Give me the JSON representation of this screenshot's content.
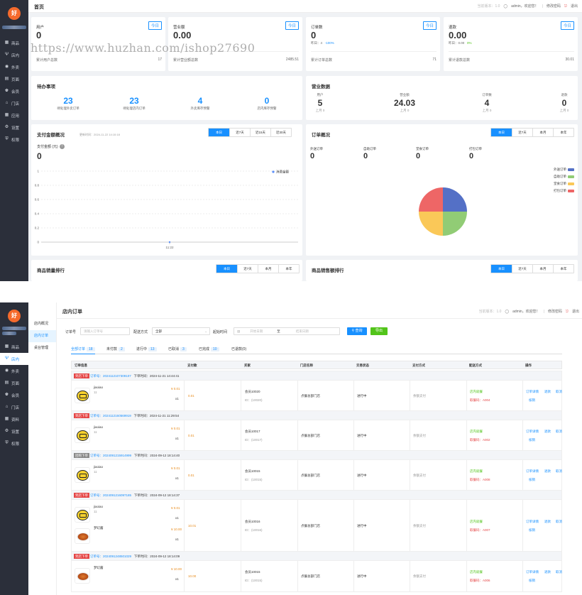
{
  "colors": {
    "sidebar": "#2b2f3a",
    "primary": "#1890ff",
    "logo": "#f56a2c",
    "pie": [
      "#5470c6",
      "#91cc75",
      "#fac858",
      "#ee6666"
    ]
  },
  "sidebar": {
    "logo": "好",
    "items1": [
      {
        "label": "商品",
        "icon": "grid-icon"
      },
      {
        "label": "店内",
        "icon": "fork-icon"
      },
      {
        "label": "外卖",
        "icon": "bag-icon"
      },
      {
        "label": "页面",
        "icon": "page-icon"
      },
      {
        "label": "会员",
        "icon": "crown-icon"
      },
      {
        "label": "门店",
        "icon": "store-icon"
      },
      {
        "label": "应用",
        "icon": "apps-icon"
      },
      {
        "label": "设置",
        "icon": "gear-icon"
      },
      {
        "label": "权限",
        "icon": "shield-icon"
      }
    ],
    "items2": [
      {
        "label": "商品",
        "icon": "grid-icon"
      },
      {
        "label": "店内",
        "icon": "fork-icon"
      },
      {
        "label": "外卖",
        "icon": "bag-icon"
      },
      {
        "label": "页面",
        "icon": "page-icon"
      },
      {
        "label": "会员",
        "icon": "crown-icon"
      },
      {
        "label": "门店",
        "icon": "store-icon"
      },
      {
        "label": "资料",
        "icon": "apps-icon"
      },
      {
        "label": "设置",
        "icon": "gear-icon"
      },
      {
        "label": "权限",
        "icon": "shield-icon"
      }
    ]
  },
  "header": {
    "title1": "首页",
    "title2": "店内订单",
    "version": "当前版本：1.0",
    "user": "admin，欢迎您！",
    "change_pwd": "修改密码",
    "logout": "退出"
  },
  "watermark": "https://www.huzhan.com/ishop27690",
  "stats": [
    {
      "title": "用户",
      "badge": "今日",
      "value": "0",
      "sub_label": "",
      "sub_a": "",
      "sub_b": "",
      "foot_label": "累计用户总数",
      "foot_value": "17"
    },
    {
      "title": "营业额",
      "badge": "今日",
      "value": "0.00",
      "sub_label": "",
      "sub_a": "",
      "sub_b": "",
      "foot_label": "累计营业额总数",
      "foot_value": "2485.51"
    },
    {
      "title": "订单数",
      "badge": "今日",
      "value": "0",
      "sub_label": "昨日：4",
      "sub_a": "-100%",
      "sub_b": "",
      "foot_label": "累计订单总数",
      "foot_value": "71"
    },
    {
      "title": "退款",
      "badge": "今日",
      "value": "0.00",
      "sub_label": "昨日：0.00",
      "sub_a": "0%",
      "sub_b": "",
      "foot_label": "累计退款总数",
      "foot_value": "30.01"
    }
  ],
  "todo": {
    "title": "待办事项",
    "items": [
      {
        "value": "23",
        "label": "待处理外卖订单"
      },
      {
        "value": "23",
        "label": "待处理店内订单"
      },
      {
        "value": "4",
        "label": "外卖库存预警"
      },
      {
        "value": "0",
        "label": "店内库存预警"
      }
    ]
  },
  "business": {
    "title": "营业数据",
    "items": [
      {
        "label": "用户",
        "value": "5",
        "sub": "上月 0"
      },
      {
        "label": "营业额",
        "value": "24.03",
        "sub": "上月 0"
      },
      {
        "label": "订单数",
        "value": "4",
        "sub": "上月 0"
      },
      {
        "label": "退款",
        "value": "0",
        "sub": "上月 0"
      }
    ]
  },
  "pay": {
    "title": "支付金额概况",
    "updated": "更新时间：2024-11-22 14:10:18",
    "tabs": [
      "本日",
      "近7天",
      "近15天",
      "近30天"
    ],
    "metric_label": "支付金额 (元)",
    "metric_value": "0",
    "legend": "消费金额"
  },
  "orders_overview": {
    "title": "订单概况",
    "tabs": [
      "本日",
      "近7天",
      "本月",
      "本年"
    ],
    "items": [
      {
        "label": "外送订单",
        "value": "0"
      },
      {
        "label": "自助订单",
        "value": "0"
      },
      {
        "label": "堂食订单",
        "value": "0"
      },
      {
        "label": "打包订单",
        "value": "0"
      }
    ],
    "legend": [
      "外送订单",
      "自助订单",
      "堂食订单",
      "打包订单"
    ]
  },
  "rank1": {
    "title": "商品销量排行",
    "tabs": [
      "本日",
      "近7天",
      "本月",
      "本年"
    ]
  },
  "rank2": {
    "title": "商品销售额排行",
    "tabs": [
      "本日",
      "近7天",
      "本月",
      "本年"
    ]
  },
  "chart_data": {
    "type": "line",
    "x": [
      "11:22"
    ],
    "yticks": [
      "1",
      "0.8",
      "0.6",
      "0.4",
      "0.2",
      "0"
    ],
    "ylim": [
      0,
      1
    ],
    "series": [
      {
        "name": "消费金额",
        "values": [
          0
        ]
      }
    ],
    "pie": {
      "type": "pie",
      "labels": [
        "外送订单",
        "自助订单",
        "堂食订单",
        "打包订单"
      ],
      "values": [
        1,
        1,
        1,
        1
      ]
    }
  },
  "store_orders": {
    "submenu": [
      "店内概况",
      "店内订单",
      "桌台管理"
    ],
    "filters": {
      "order_no_label": "订单号",
      "order_no_ph": "请输入订单号",
      "delivery_label": "配送方式",
      "delivery_value": "全部",
      "time_label": "起始时间",
      "start_ph": "开始日期",
      "to": "至",
      "end_ph": "结束日期",
      "search": "查询",
      "export": "导出"
    },
    "tabs": [
      {
        "label": "全部订单",
        "count": "18"
      },
      {
        "label": "未付款",
        "count": "2"
      },
      {
        "label": "进行中",
        "count": "13"
      },
      {
        "label": "已取消",
        "count": "3"
      },
      {
        "label": "已完成",
        "count": "10"
      },
      {
        "label": "已退款",
        "count": "(0)"
      }
    ],
    "columns": [
      "订单信息",
      "支付款",
      "买家",
      "门店名称",
      "交易状态",
      "支付方式",
      "配送方式",
      "操作"
    ],
    "orders": [
      {
        "tag": "到店下单",
        "no": "订单号：2024112107309107",
        "time": "下单时间：2024-11-21 14:44:41",
        "products": [
          {
            "name": "jiaoiao",
            "spec": "11",
            "price": "¥ 0.01",
            "qty": "x1",
            "img": "ticket"
          }
        ],
        "pay": "0.01",
        "buyer": "会员10020",
        "buyer_id": "ID：(10020)",
        "store": "点餐总部门店",
        "status": "进行中",
        "method": "余额支付",
        "delivery": "店内就餐",
        "pickup": "取餐码：A004",
        "ops": [
          "订单详情",
          "退款",
          "取消",
          "核销"
        ]
      },
      {
        "tag": "到店下单",
        "no": "订单号：2024112160569919",
        "time": "下单时间：2024-11-21 11:29:54",
        "products": [
          {
            "name": "jiaoiao",
            "spec": "11",
            "price": "¥ 0.01",
            "qty": "x1",
            "img": "ticket"
          }
        ],
        "pay": "0.01",
        "buyer": "会员10017",
        "buyer_id": "ID：(10017)",
        "store": "点餐总部门店",
        "status": "进行中",
        "method": "余额支付",
        "delivery": "店内就餐",
        "pickup": "取餐码：A002",
        "ops": [
          "订单详情",
          "退款",
          "取消",
          "核销"
        ]
      },
      {
        "tag": "团购下单",
        "no": "订单号：2024091215914999",
        "time": "下单时间：2024-09-12 18:14:40",
        "products": [
          {
            "name": "jiaoiao",
            "spec": "11",
            "price": "¥ 0.01",
            "qty": "x1",
            "img": "ticket"
          }
        ],
        "pay": "0.01",
        "buyer": "会员10015",
        "buyer_id": "ID：(10015)",
        "store": "点餐总部门店",
        "status": "进行中",
        "method": "余额支付",
        "delivery": "店内就餐",
        "pickup": "取餐码：A008",
        "ops": [
          "订单详情",
          "退款",
          "取消",
          "核销"
        ]
      },
      {
        "tag": "到店下单",
        "no": "订单号：2024091216097185",
        "time": "下单时间：2024-09-12 18:14:37",
        "products": [
          {
            "name": "jiaoiao",
            "spec": "11",
            "price": "¥ 0.01",
            "qty": "x1",
            "img": "ticket"
          },
          {
            "name": "梦幻酱",
            "spec": "",
            "price": "¥ 10.00",
            "qty": "x1",
            "img": "dish"
          }
        ],
        "pay": "10.01",
        "buyer": "会员10016",
        "buyer_id": "ID：(10016)",
        "store": "点餐总部门店",
        "status": "进行中",
        "method": "余额支付",
        "delivery": "店内就餐",
        "pickup": "取餐码：A007",
        "ops": [
          "订单详情",
          "退款",
          "取消",
          "核销"
        ]
      },
      {
        "tag": "到店下单",
        "no": "订单号：2024091248501029",
        "time": "下单时间：2024-09-12 18:14:09",
        "products": [
          {
            "name": "梦幻酱",
            "spec": "",
            "price": "¥ 10.00",
            "qty": "x1",
            "img": "dish"
          }
        ],
        "pay": "10.00",
        "buyer": "会员10015",
        "buyer_id": "ID：(10015)",
        "store": "点餐总部门店",
        "status": "进行中",
        "method": "余额支付",
        "delivery": "店内就餐",
        "pickup": "取餐码：A006",
        "ops": [
          "订单详情",
          "退款",
          "取消",
          "核销"
        ]
      }
    ]
  }
}
